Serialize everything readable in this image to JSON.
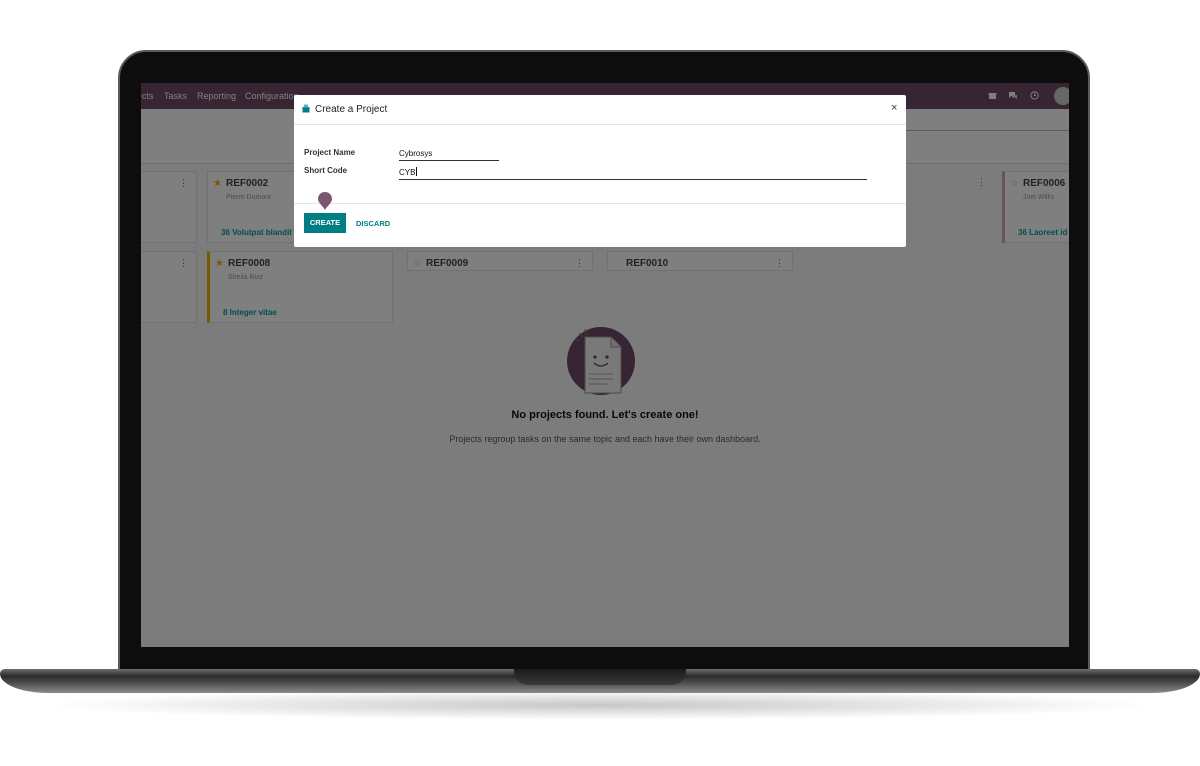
{
  "navbar": {
    "items": [
      "ects",
      "Tasks",
      "Reporting",
      "Configuration"
    ],
    "icons": [
      "gift-icon",
      "chat-icon",
      "clock-icon"
    ]
  },
  "kanban": {
    "cards": [
      {
        "ref": "REF0002",
        "subtitle": "Pierre Dumont",
        "tasks": "36 Volutpat blandit",
        "starred": true
      },
      {
        "ref": "REF0006",
        "subtitle": "Joel Willis",
        "tasks": "36 Laoreet id",
        "starred": false
      },
      {
        "ref": "REF0008",
        "subtitle": "Sheila Ruiz",
        "tasks": "8 Integer vitae",
        "starred": true
      },
      {
        "ref": "REF0009",
        "subtitle": "",
        "tasks": "",
        "starred": false
      },
      {
        "ref": "REF0010",
        "subtitle": "",
        "tasks": "",
        "starred": false
      }
    ]
  },
  "empty": {
    "title": "No projects found. Let's create one!",
    "subtitle": "Projects regroup tasks on the same topic and each have their own dashboard."
  },
  "dialog": {
    "title": "Create a Project",
    "close": "×",
    "fields": [
      {
        "label": "Project Name",
        "value": "Cybrosys"
      },
      {
        "label": "Short Code",
        "value": "CYB"
      }
    ],
    "create_label": "CREATE",
    "discard_label": "DISCARD"
  },
  "colors": {
    "navbar": "#714b67",
    "accent": "#017e84",
    "star": "#f0b400"
  }
}
